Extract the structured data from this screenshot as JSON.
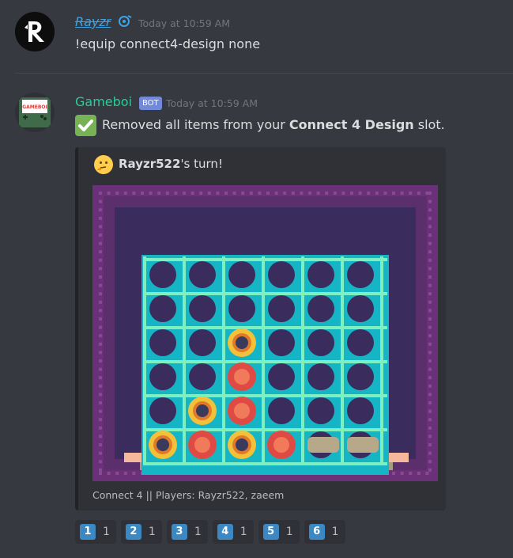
{
  "message1": {
    "username": "Rayzr",
    "timestamp": "Today at 10:59 AM",
    "content": "!equip connect4-design none"
  },
  "message2": {
    "username": "Gameboi",
    "bot_badge": "BOT",
    "timestamp": "Today at 10:59 AM",
    "content_prefix": "Removed all items from your ",
    "content_bold": "Connect 4 Design",
    "content_suffix": " slot.",
    "gameboy_label": "GAMEBOI",
    "embed": {
      "author_name": "Rayzr522",
      "author_suffix": "'s turn!",
      "footer": "Connect 4 || Players: Rayzr522, zaeem"
    }
  },
  "board": {
    "columns": 6,
    "rows": 6,
    "pieces": [
      {
        "col": 2,
        "row": 2,
        "player": "yellow"
      },
      {
        "col": 2,
        "row": 3,
        "player": "red"
      },
      {
        "col": 1,
        "row": 4,
        "player": "yellow"
      },
      {
        "col": 2,
        "row": 4,
        "player": "red"
      },
      {
        "col": 0,
        "row": 5,
        "player": "yellow"
      },
      {
        "col": 1,
        "row": 5,
        "player": "red"
      },
      {
        "col": 2,
        "row": 5,
        "player": "yellow"
      },
      {
        "col": 3,
        "row": 5,
        "player": "red"
      }
    ],
    "colors": {
      "frame": "#15b5c5",
      "frame_light": "#7ef0c0",
      "hole": "#3a2c5c",
      "bg_outer": "#6a3078",
      "bg_inner": "#3a2c5c",
      "red": "#e04a44",
      "yellow": "#f3c03a",
      "ground": "#f5b89a"
    }
  },
  "reactions": [
    {
      "emoji": "1",
      "count": "1"
    },
    {
      "emoji": "2",
      "count": "1"
    },
    {
      "emoji": "3",
      "count": "1"
    },
    {
      "emoji": "4",
      "count": "1"
    },
    {
      "emoji": "5",
      "count": "1"
    },
    {
      "emoji": "6",
      "count": "1"
    }
  ],
  "colors": {
    "background": "#36393f",
    "username_user": "#3ba3e6",
    "username_bot": "#2ecc98",
    "bot_badge": "#7289da"
  }
}
